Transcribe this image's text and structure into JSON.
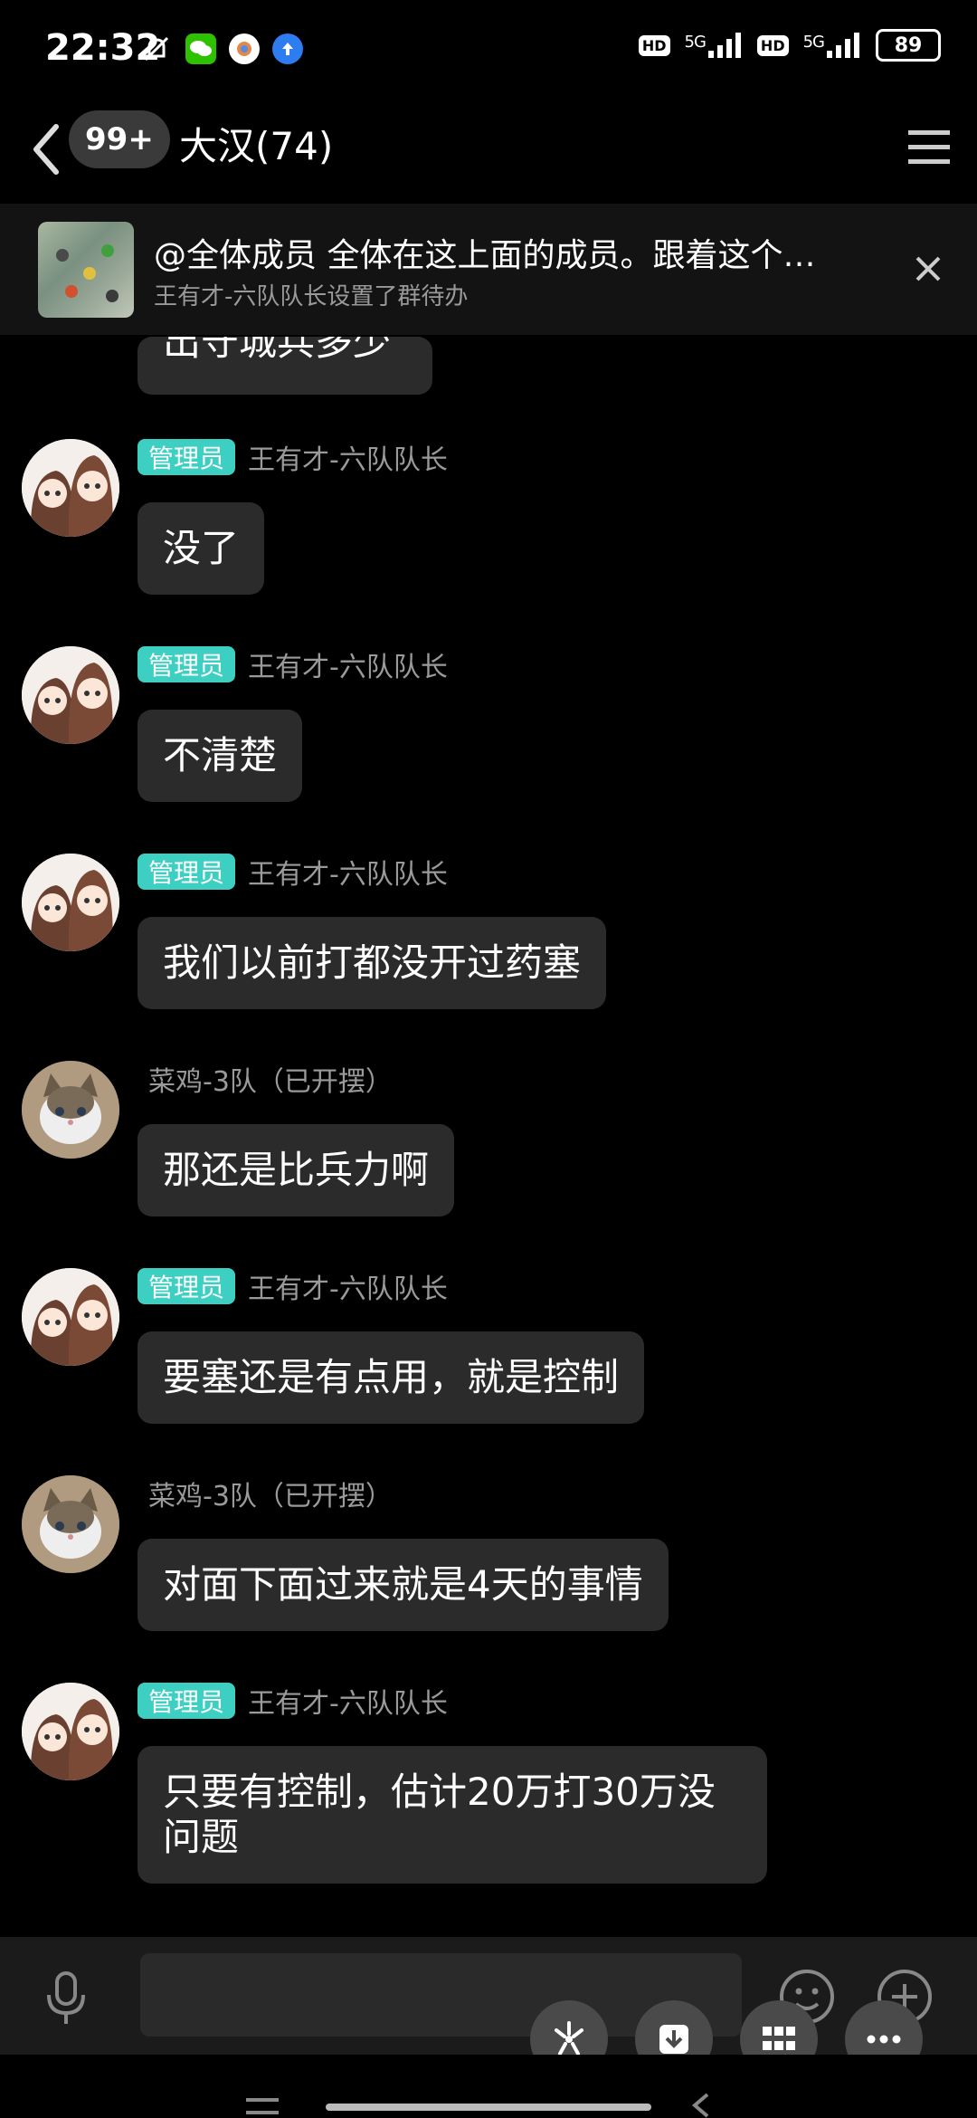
{
  "status": {
    "time": "22:32",
    "hd1": "HD",
    "net1": "5G",
    "hd2": "HD",
    "net2": "5G",
    "battery": "89"
  },
  "header": {
    "unread_badge": "99+",
    "title": "大汉(74)"
  },
  "pinned": {
    "text": "@全体成员 全体在这上面的成员。跟着这个…",
    "sub": "王有才-六队队长设置了群待办"
  },
  "partial_message": "出守城兵多少",
  "messages": [
    {
      "tag": "管理员",
      "name": "王有才-六队队长",
      "text": "没了"
    },
    {
      "tag": "管理员",
      "name": "王有才-六队队长",
      "text": "不清楚"
    },
    {
      "tag": "管理员",
      "name": "王有才-六队队长",
      "text": "我们以前打都没开过药塞"
    },
    {
      "tag": "",
      "name": "菜鸡-3队（已开摆）",
      "text": "那还是比兵力啊"
    },
    {
      "tag": "管理员",
      "name": "王有才-六队队长",
      "text": "要塞还是有点用，就是控制"
    },
    {
      "tag": "",
      "name": "菜鸡-3队（已开摆）",
      "text": "对面下面过来就是4天的事情"
    },
    {
      "tag": "管理员",
      "name": "王有才-六队队长",
      "text": "只要有控制，估计20万打30万没问题"
    }
  ],
  "colors": {
    "accent_tag": "#3ecfc3",
    "bubble": "#2b2b2b",
    "background": "#000000"
  },
  "icons": {
    "back": "chevron-left-icon",
    "menu": "hamburger-menu-icon",
    "close": "close-icon",
    "mic": "microphone-icon",
    "emoji": "emoji-icon",
    "plus": "plus-circle-icon"
  }
}
